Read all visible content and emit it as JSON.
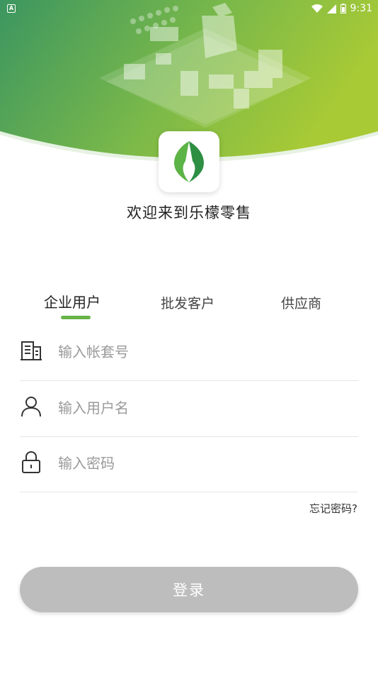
{
  "status_bar": {
    "time": "9:31",
    "app_badge": "A"
  },
  "welcome_text": "欢迎来到乐檬零售",
  "tabs": [
    {
      "label": "企业用户",
      "active": true
    },
    {
      "label": "批发客户",
      "active": false
    },
    {
      "label": "供应商",
      "active": false
    }
  ],
  "fields": {
    "account": {
      "placeholder": "输入帐套号",
      "value": "",
      "icon": "building-icon"
    },
    "username": {
      "placeholder": "输入用户名",
      "value": "",
      "icon": "user-icon"
    },
    "password": {
      "placeholder": "输入密码",
      "value": "",
      "icon": "lock-icon"
    }
  },
  "forgot_password": "忘记密码?",
  "login_button": "登录",
  "colors": {
    "accent": "#67b346",
    "header_green_dark": "#3f9a5c",
    "header_green_light": "#a9cc3a",
    "button_disabled": "#bdbdbd"
  }
}
